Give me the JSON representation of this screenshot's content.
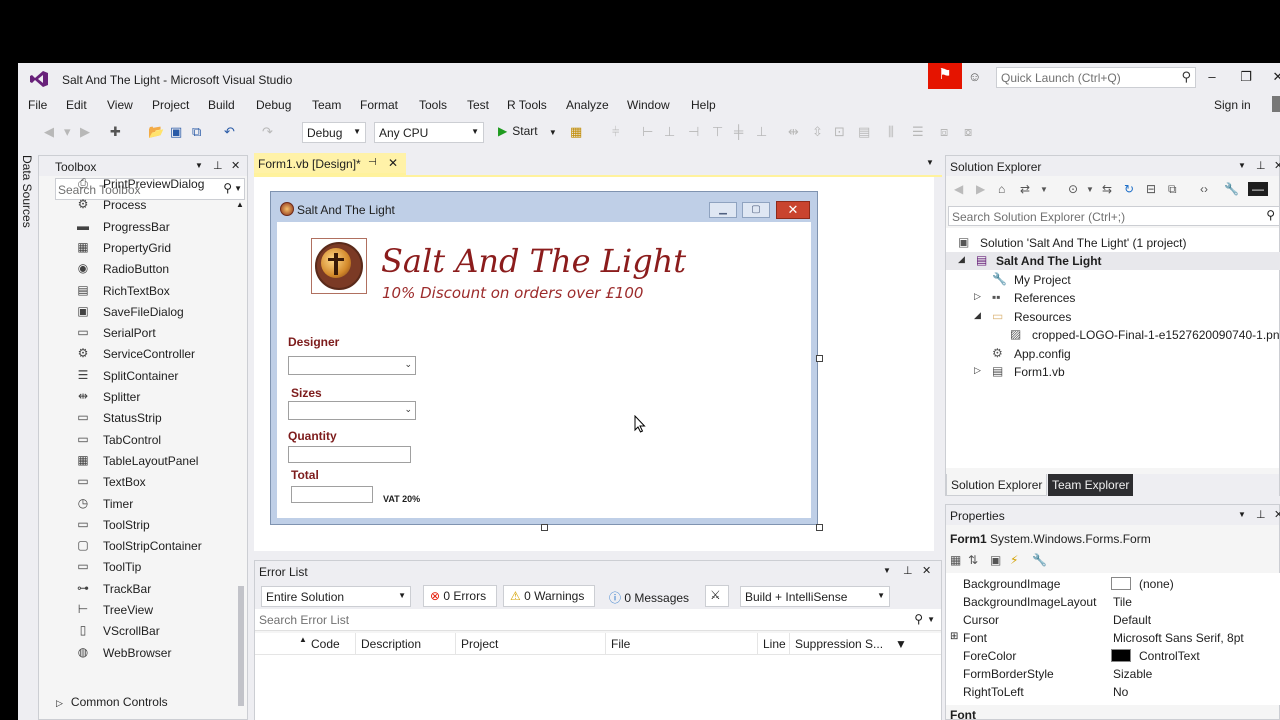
{
  "window": {
    "title": "Salt And The Light - Microsoft Visual Studio",
    "quick_launch_placeholder": "Quick Launch (Ctrl+Q)",
    "sign_in": "Sign in"
  },
  "menu": [
    "File",
    "Edit",
    "View",
    "Project",
    "Build",
    "Debug",
    "Team",
    "Format",
    "Tools",
    "Test",
    "R Tools",
    "Analyze",
    "Window",
    "Help"
  ],
  "toolbar": {
    "config": "Debug",
    "platform": "Any CPU",
    "start_label": "Start"
  },
  "left_tab": "Data Sources",
  "toolbox": {
    "title": "Toolbox",
    "search_placeholder": "Search Toolbox",
    "items": [
      {
        "label": "PrintPreviewDialog",
        "icon": "print-preview-icon"
      },
      {
        "label": "Process",
        "icon": "process-icon"
      },
      {
        "label": "ProgressBar",
        "icon": "progressbar-icon"
      },
      {
        "label": "PropertyGrid",
        "icon": "propertygrid-icon"
      },
      {
        "label": "RadioButton",
        "icon": "radiobutton-icon"
      },
      {
        "label": "RichTextBox",
        "icon": "richtextbox-icon"
      },
      {
        "label": "SaveFileDialog",
        "icon": "savefiledialog-icon"
      },
      {
        "label": "SerialPort",
        "icon": "serialport-icon"
      },
      {
        "label": "ServiceController",
        "icon": "servicecontroller-icon"
      },
      {
        "label": "SplitContainer",
        "icon": "splitcontainer-icon"
      },
      {
        "label": "Splitter",
        "icon": "splitter-icon"
      },
      {
        "label": "StatusStrip",
        "icon": "statusstrip-icon"
      },
      {
        "label": "TabControl",
        "icon": "tabcontrol-icon"
      },
      {
        "label": "TableLayoutPanel",
        "icon": "tablelayoutpanel-icon"
      },
      {
        "label": "TextBox",
        "icon": "textbox-icon"
      },
      {
        "label": "Timer",
        "icon": "timer-icon"
      },
      {
        "label": "ToolStrip",
        "icon": "toolstrip-icon"
      },
      {
        "label": "ToolStripContainer",
        "icon": "toolstripcontainer-icon"
      },
      {
        "label": "ToolTip",
        "icon": "tooltip-icon"
      },
      {
        "label": "TrackBar",
        "icon": "trackbar-icon"
      },
      {
        "label": "TreeView",
        "icon": "treeview-icon"
      },
      {
        "label": "VScrollBar",
        "icon": "vscrollbar-icon"
      },
      {
        "label": "WebBrowser",
        "icon": "webbrowser-icon"
      }
    ],
    "group": "Common Controls"
  },
  "designer": {
    "tab_label": "Form1.vb [Design]*",
    "form": {
      "title": "Salt And The Light",
      "brand_title": "Salt And The Light",
      "brand_subtitle": "10% Discount on orders over £100",
      "designer_label": "Designer",
      "sizes_label": "Sizes",
      "quantity_label": "Quantity",
      "total_label": "Total",
      "vat_label": "VAT 20%"
    }
  },
  "error_list": {
    "title": "Error List",
    "scope": "Entire Solution",
    "errors": "0 Errors",
    "warnings": "0 Warnings",
    "messages": "0 Messages",
    "build_filter": "Build + IntelliSense",
    "search_placeholder": "Search Error List",
    "columns": [
      "Code",
      "Description",
      "Project",
      "File",
      "Line",
      "Suppression S..."
    ]
  },
  "solution_explorer": {
    "title": "Solution Explorer",
    "search_placeholder": "Search Solution Explorer (Ctrl+;)",
    "solution": "Solution 'Salt And The Light' (1 project)",
    "project": "Salt And The Light",
    "nodes": {
      "my_project": "My Project",
      "references": "References",
      "resources": "Resources",
      "resource_file": "cropped-LOGO-Final-1-e1527620090740-1.png",
      "app_config": "App.config",
      "form1": "Form1.vb"
    },
    "tabs": [
      "Solution Explorer",
      "Team Explorer"
    ]
  },
  "properties": {
    "title": "Properties",
    "object_name": "Form1",
    "object_type": "System.Windows.Forms.Form",
    "rows": [
      {
        "name": "BackgroundImage",
        "value": "(none)"
      },
      {
        "name": "BackgroundImageLayout",
        "value": "Tile"
      },
      {
        "name": "Cursor",
        "value": "Default"
      },
      {
        "name": "Font",
        "value": "Microsoft Sans Serif, 8pt"
      },
      {
        "name": "ForeColor",
        "value": "ControlText"
      },
      {
        "name": "FormBorderStyle",
        "value": "Sizable"
      },
      {
        "name": "RightToLeft",
        "value": "No"
      }
    ],
    "description_title": "Font",
    "colors": {
      "forecolor_swatch": "#000000",
      "bgimage_swatch": "#ffffff"
    }
  },
  "colors": {
    "accent_tab": "#fff29d",
    "notification": "#e51400",
    "brand_red": "#8b1c1c"
  }
}
